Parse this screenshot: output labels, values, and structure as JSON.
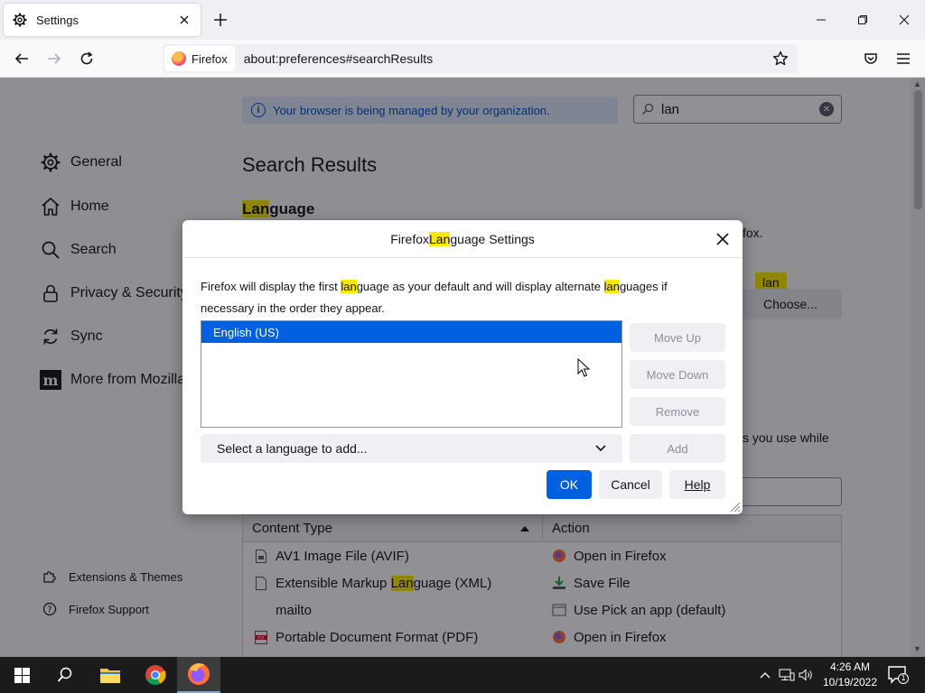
{
  "browser": {
    "tab_title": "Settings",
    "identity_label": "Firefox",
    "url": "about:preferences#searchResults"
  },
  "page": {
    "policy_notice": "Your browser is being managed by your organization.",
    "search_value": "lan",
    "results_title": "Search Results",
    "language_heading": {
      "match": "Lan",
      "rest": "guage"
    },
    "bg_text_fox": "fox.",
    "bg_tooltip": "lan",
    "bg_choose_button": "Choose...",
    "bg_text_use_while": "s you use while",
    "sidebar": {
      "items": [
        {
          "label": "General",
          "icon": "gear-icon"
        },
        {
          "label": "Home",
          "icon": "home-icon"
        },
        {
          "label": "Search",
          "icon": "search-icon"
        },
        {
          "label": "Privacy & Security",
          "icon": "lock-icon"
        },
        {
          "label": "Sync",
          "icon": "sync-icon"
        },
        {
          "label": "More from Mozilla",
          "icon": "mozilla-icon"
        }
      ],
      "footer": [
        {
          "label": "Extensions & Themes",
          "icon": "puzzle-icon"
        },
        {
          "label": "Firefox Support",
          "icon": "help-icon"
        }
      ]
    },
    "table": {
      "headers": {
        "content_type": "Content Type",
        "action": "Action"
      },
      "rows": [
        {
          "type": "AV1 Image File (AVIF)",
          "action": "Open in Firefox"
        },
        {
          "type_pre": "Extensible Markup ",
          "type_match": "Lan",
          "type_post": "guage (XML)",
          "action": "Save File"
        },
        {
          "type": "mailto",
          "action": "Use Pick an app (default)"
        },
        {
          "type": "Portable Document Format (PDF)",
          "action": "Open in Firefox"
        }
      ]
    }
  },
  "dialog": {
    "title": {
      "pre": "Firefox ",
      "match": "Lan",
      "post": "guage Settings"
    },
    "description": {
      "p1": "Firefox will display the first ",
      "m1": "lan",
      "p2": "guage as your default and will display alternate ",
      "m2": "lan",
      "p3": "guages if necessary in the order they appear."
    },
    "languages": [
      "English (US)"
    ],
    "buttons": {
      "move_up": "Move Up",
      "move_down": "Move Down",
      "remove": "Remove",
      "add": "Add",
      "ok": "OK",
      "cancel": "Cancel",
      "help": "Help"
    },
    "select_placeholder": "Select a language to add..."
  },
  "taskbar": {
    "time": "4:26 AM",
    "date": "10/19/2022",
    "notification_count": "1"
  },
  "colors": {
    "accent": "#0061e0",
    "highlight": "#ffe900",
    "selection": "#0060df"
  }
}
